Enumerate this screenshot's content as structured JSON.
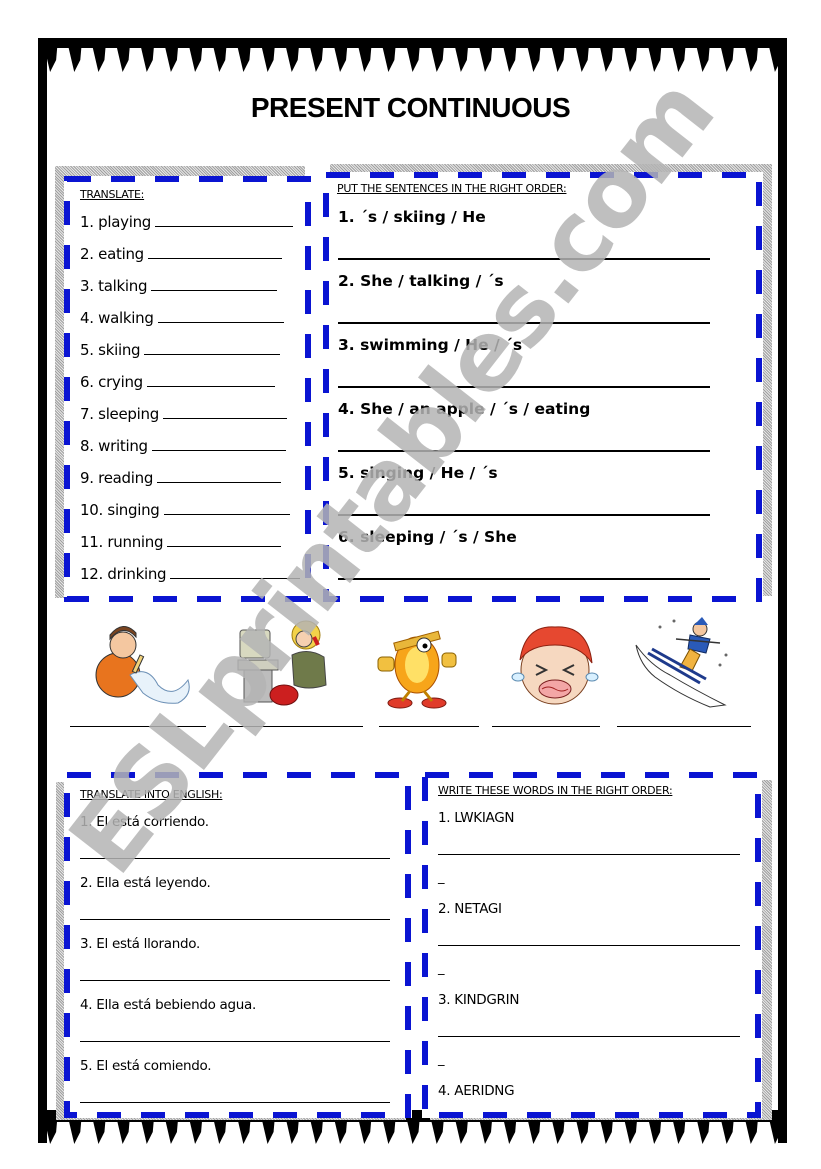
{
  "title": "PRESENT CONTINUOUS",
  "colors": {
    "dash_blue": "#0a14d2",
    "frame_black": "#000000",
    "watermark_gray": "#b4b4b4"
  },
  "translate": {
    "heading": "TRANSLATE:",
    "items": [
      "1. playing",
      "2. eating",
      "3. talking",
      "4. walking",
      "5. skiing",
      "6.  crying",
      "7. sleeping",
      "8. writing",
      "9. reading",
      "10. singing",
      "11. running",
      "12. drinking"
    ]
  },
  "order_sentences": {
    "heading": "PUT THE SENTENCES IN THE RIGHT ORDER:",
    "items": [
      "1. ´s / skiing / He",
      "2. She / talking / ´s",
      "3. swimming / He / ´s",
      "4. She / an apple / ´s / eating",
      "5. singing / He / ´s",
      "6. sleeping / ´s / She"
    ]
  },
  "pictures": [
    {
      "icon": "boy-writing-icon"
    },
    {
      "icon": "woman-talking-on-phone-icon"
    },
    {
      "icon": "running-character-icon"
    },
    {
      "icon": "girl-crying-icon"
    },
    {
      "icon": "skier-icon"
    }
  ],
  "translate_english": {
    "heading": "TRANSLATE INTO ENGLISH:",
    "items": [
      "1. El está corriendo.",
      "2. Ella está leyendo.",
      "3. El está llorando.",
      "4. Ella está bebiendo agua.",
      "5. El está comiendo."
    ]
  },
  "word_order": {
    "heading": "WRITE THESE WORDS IN THE RIGHT ORDER:",
    "items": [
      "1. LWKIAGN",
      "2. NETAGI",
      "3. KINDGRIN",
      "4. AERIDNG"
    ],
    "dash": "_"
  },
  "watermark": "ESLprintables.com"
}
